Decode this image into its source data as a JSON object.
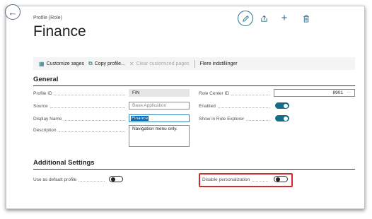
{
  "header": {
    "caption": "Profile (Role)",
    "title": "Finance"
  },
  "icons": {
    "back": "arrow-left-icon",
    "edit": "pencil-icon",
    "share": "share-icon",
    "new": "plus-icon",
    "delete": "trash-icon"
  },
  "toolbar": {
    "customize": "Customize зages",
    "copy": "Copy profile...",
    "clear": "Clear customized pages",
    "more": "Flere indstillinger"
  },
  "general": {
    "heading": "General",
    "profile_id_label": "Profile ID",
    "profile_id": "FIN",
    "source_label": "Source",
    "source": "Base Application",
    "display_name_label": "Display Name",
    "display_name": "Finance",
    "description_label": "Description",
    "description": "Navigation menu only.",
    "role_center_label": "Role Center ID",
    "role_center": "8901",
    "role_center_lookup": "···",
    "enabled_label": "Enabled",
    "enabled": true,
    "show_explorer_label": "Show in Role Explorer",
    "show_explorer": true
  },
  "additional": {
    "heading": "Additional Settings",
    "default_profile_label": "Use as default pгofile",
    "default_profile": false,
    "disable_personalization_label": "Disable personalization",
    "disable_personalization": false
  },
  "colors": {
    "accent": "#136e8a",
    "highlight": "#d72828"
  }
}
